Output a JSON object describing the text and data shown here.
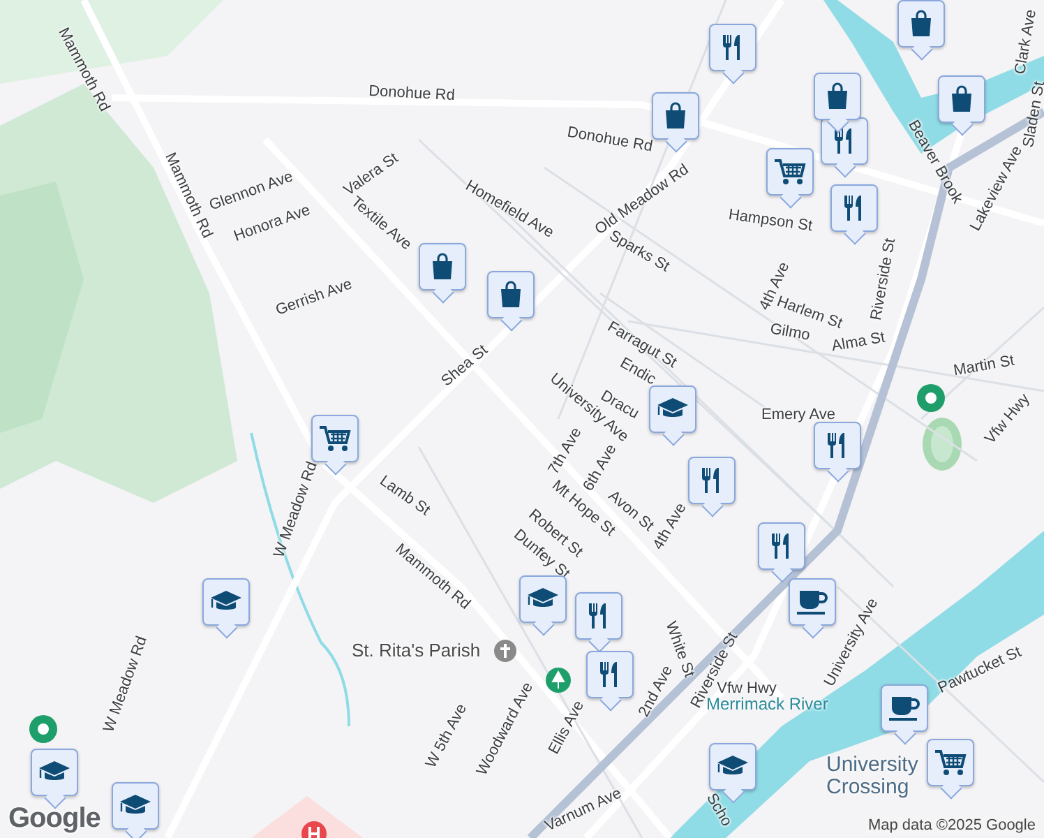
{
  "map": {
    "labels": [
      {
        "text": "Mammoth Rd"
      },
      {
        "text": "Donohue Rd"
      },
      {
        "text": "Donohue Rd"
      },
      {
        "text": "Mammoth Rd"
      },
      {
        "text": "Glennon Ave"
      },
      {
        "text": "Honora Ave"
      },
      {
        "text": "Valera St"
      },
      {
        "text": "Textile Ave"
      },
      {
        "text": "Homefield Ave"
      },
      {
        "text": "Old Meadow Rd"
      },
      {
        "text": "Hampson St"
      },
      {
        "text": "Sparks St"
      },
      {
        "text": "Gerrish Ave"
      },
      {
        "text": "4th Ave"
      },
      {
        "text": "Riverside St"
      },
      {
        "text": "Harlem St"
      },
      {
        "text": "Farragut St"
      },
      {
        "text": "Gilmo"
      },
      {
        "text": "Alma St"
      },
      {
        "text": "Martin St"
      },
      {
        "text": "Endic"
      },
      {
        "text": "Shea St"
      },
      {
        "text": "Dracu"
      },
      {
        "text": "University Ave"
      },
      {
        "text": "Emery Ave"
      },
      {
        "text": "Vfw Hwy"
      },
      {
        "text": "7th Ave"
      },
      {
        "text": "6th Ave"
      },
      {
        "text": "Lamb St"
      },
      {
        "text": "Mt Hope St"
      },
      {
        "text": "Avon St"
      },
      {
        "text": "W Meadow Rd"
      },
      {
        "text": "Robert St"
      },
      {
        "text": "4th Ave"
      },
      {
        "text": "Mammoth Rd"
      },
      {
        "text": "Dunfey St"
      },
      {
        "text": "University Ave"
      },
      {
        "text": "White St"
      },
      {
        "text": "Riverside St"
      },
      {
        "text": "Vfw Hwy"
      },
      {
        "text": "2nd Ave"
      },
      {
        "text": "W Meadow Rd"
      },
      {
        "text": "W 5th Ave"
      },
      {
        "text": "Woodward Ave"
      },
      {
        "text": "Ellis Ave"
      },
      {
        "text": "Pawtucket St"
      },
      {
        "text": "Varnum Ave"
      },
      {
        "text": "Scho"
      },
      {
        "text": "Clark Ave"
      },
      {
        "text": "Sladen St"
      },
      {
        "text": "Lakeview Ave"
      },
      {
        "text": "Beaver Brook"
      }
    ],
    "places": [
      {
        "kind": "church",
        "name": "St. Rita's Parish"
      },
      {
        "kind": "water",
        "name": "Merrimack River"
      },
      {
        "kind": "area",
        "name": "University Crossing"
      }
    ],
    "pins": [
      {
        "kind": "restaurant"
      },
      {
        "kind": "restaurant"
      },
      {
        "kind": "restaurant"
      },
      {
        "kind": "restaurant"
      },
      {
        "kind": "restaurant"
      },
      {
        "kind": "restaurant"
      },
      {
        "kind": "restaurant"
      },
      {
        "kind": "restaurant"
      },
      {
        "kind": "shopping"
      },
      {
        "kind": "shopping"
      },
      {
        "kind": "shopping"
      },
      {
        "kind": "shopping"
      },
      {
        "kind": "shopping"
      },
      {
        "kind": "shopping"
      },
      {
        "kind": "grocery"
      },
      {
        "kind": "grocery"
      },
      {
        "kind": "grocery"
      },
      {
        "kind": "school"
      },
      {
        "kind": "school"
      },
      {
        "kind": "school"
      },
      {
        "kind": "school"
      },
      {
        "kind": "school"
      },
      {
        "kind": "school"
      },
      {
        "kind": "cafe"
      },
      {
        "kind": "cafe"
      }
    ],
    "attribution": "Map data ©2025 Google",
    "logo": "Google"
  }
}
